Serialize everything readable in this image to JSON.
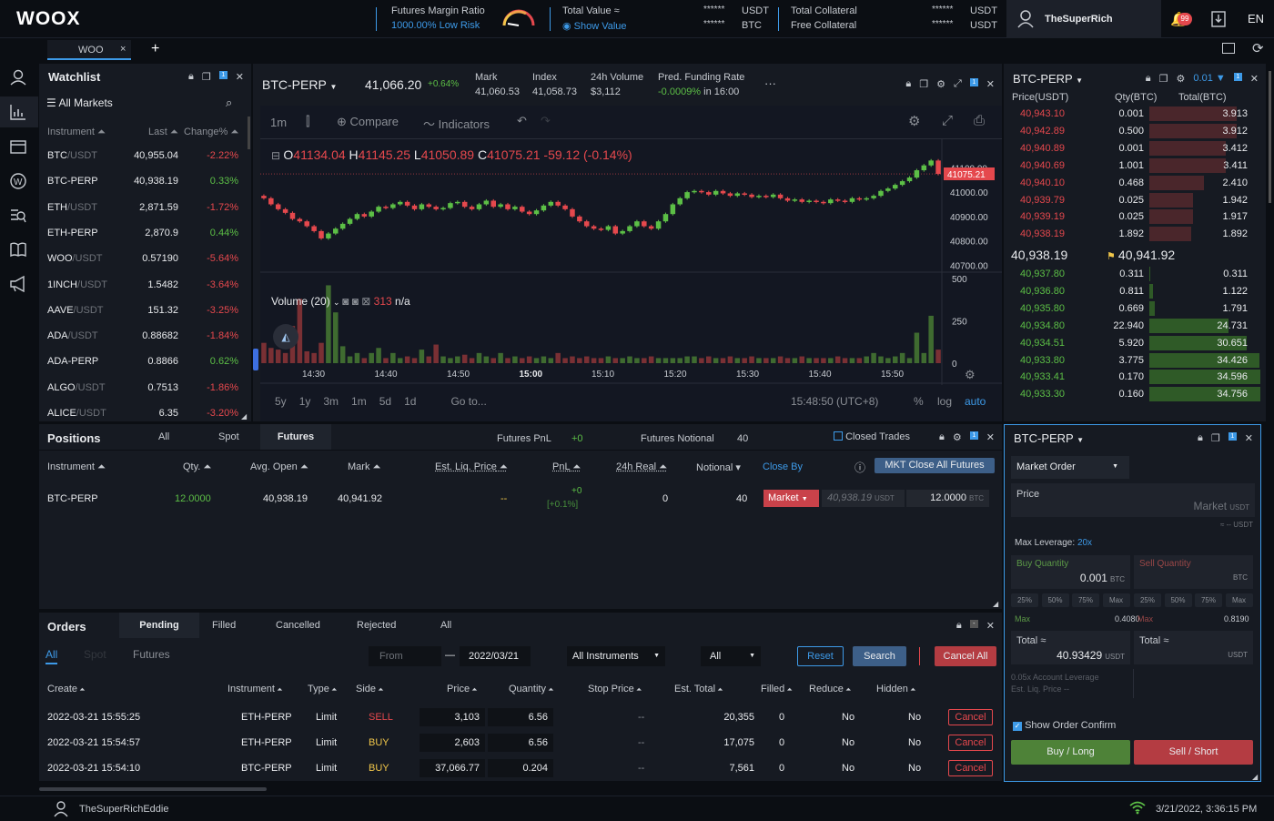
{
  "topbar": {
    "logo": "WOOX",
    "margin_ratio_label": "Futures Margin Ratio",
    "margin_ratio_value": "1000.00%",
    "margin_ratio_risk": "Low Risk",
    "total_value_label": "Total Value ≈",
    "show_value": "Show Value",
    "hidden_1": "******",
    "hidden_1_unit": "USDT",
    "hidden_2": "******",
    "hidden_2_unit": "BTC",
    "total_collateral": "Total Collateral",
    "free_collateral": "Free Collateral",
    "hidden_3": "******",
    "hidden_3_unit": "USDT",
    "hidden_4": "******",
    "hidden_4_unit": "USDT",
    "username": "TheSuperRich",
    "notif_count": "99",
    "lang": "EN"
  },
  "tabs": {
    "tab1": "WOO",
    "close": "×",
    "add": "+"
  },
  "watchlist": {
    "title": "Watchlist",
    "all_markets": "All Markets",
    "cols": [
      "Instrument",
      "Last",
      "Change%"
    ],
    "rows": [
      {
        "base": "BTC",
        "quote": "/USDT",
        "last": "40,955.04",
        "chg": "-2.22%",
        "up": false
      },
      {
        "base": "BTC-PERP",
        "quote": "",
        "last": "40,938.19",
        "chg": "0.33%",
        "up": true
      },
      {
        "base": "ETH",
        "quote": "/USDT",
        "last": "2,871.59",
        "chg": "-1.72%",
        "up": false
      },
      {
        "base": "ETH-PERP",
        "quote": "",
        "last": "2,870.9",
        "chg": "0.44%",
        "up": true
      },
      {
        "base": "WOO",
        "quote": "/USDT",
        "last": "0.57190",
        "chg": "-5.64%",
        "up": false
      },
      {
        "base": "1INCH",
        "quote": "/USDT",
        "last": "1.5482",
        "chg": "-3.64%",
        "up": false
      },
      {
        "base": "AAVE",
        "quote": "/USDT",
        "last": "151.32",
        "chg": "-3.25%",
        "up": false
      },
      {
        "base": "ADA",
        "quote": "/USDT",
        "last": "0.88682",
        "chg": "-1.84%",
        "up": false
      },
      {
        "base": "ADA-PERP",
        "quote": "",
        "last": "0.8866",
        "chg": "0.62%",
        "up": true
      },
      {
        "base": "ALGO",
        "quote": "/USDT",
        "last": "0.7513",
        "chg": "-1.86%",
        "up": false
      },
      {
        "base": "ALICE",
        "quote": "/USDT",
        "last": "6.35",
        "chg": "-3.20%",
        "up": false
      }
    ]
  },
  "chart_header": {
    "symbol": "BTC-PERP",
    "price": "41,066.20",
    "change": "+0.64%",
    "mark_label": "Mark",
    "mark": "41,060.53",
    "index_label": "Index",
    "index": "41,058.73",
    "vol_label": "24h Volume",
    "vol": "$3,112",
    "funding_label": "Pred. Funding Rate",
    "funding": "-0.0009%",
    "funding_time": "in 16:00",
    "more": "···"
  },
  "chart_toolbar": {
    "interval": "1m",
    "compare": "Compare",
    "indicators": "Indicators"
  },
  "ohlc": {
    "o": "41134.04",
    "h": "41145.25",
    "l": "41050.89",
    "c": "41075.21",
    "chg": "-59.12 (-0.14%)"
  },
  "volume_label": {
    "name": "Volume (20)",
    "val": "313",
    "na": "n/a"
  },
  "chart_footer": {
    "ranges": [
      "5y",
      "1y",
      "3m",
      "1m",
      "5d",
      "1d"
    ],
    "goto": "Go to...",
    "time": "15:48:50 (UTC+8)",
    "pct": "%",
    "log": "log",
    "auto": "auto"
  },
  "chart_data": {
    "type": "candlestick",
    "x_ticks": [
      "14:30",
      "14:40",
      "14:50",
      "15:00",
      "15:10",
      "15:20",
      "15:30",
      "15:40",
      "15:50"
    ],
    "y_ticks": [
      "41100.00",
      "41000.00",
      "40900.00",
      "40800.00",
      "40700.00"
    ],
    "last_price_label": "41075.21",
    "ylim": [
      40690,
      41180
    ],
    "volume_ticks": [
      "500",
      "250",
      "0"
    ],
    "close_series": [
      40975,
      40950,
      40930,
      40915,
      40890,
      40880,
      40860,
      40840,
      40810,
      40830,
      40850,
      40870,
      40890,
      40910,
      40900,
      40920,
      40940,
      40935,
      40950,
      40960,
      40945,
      40930,
      40950,
      40940,
      40930,
      40935,
      40955,
      40960,
      40940,
      40930,
      40950,
      40965,
      40940,
      40950,
      40930,
      40940,
      40920,
      40910,
      40925,
      40945,
      40960,
      40945,
      40930,
      40900,
      40880,
      40860,
      40850,
      40845,
      40860,
      40830,
      40840,
      40860,
      40880,
      40860,
      40850,
      40880,
      40910,
      40950,
      40975,
      41000,
      41005,
      41000,
      40990,
      41005,
      40995,
      40985,
      40995,
      40990,
      40980,
      40985,
      40980,
      40990,
      40975,
      40965,
      40970,
      40960,
      40965,
      40960,
      40955,
      40970,
      40965,
      40960,
      40975,
      40970,
      40975,
      40985,
      41005,
      41015,
      41030,
      41045,
      41060,
      41090,
      41110,
      41130,
      41075
    ],
    "volume_series": [
      120,
      90,
      80,
      60,
      220,
      380,
      70,
      60,
      120,
      460,
      300,
      100,
      40,
      60,
      30,
      60,
      90,
      30,
      60,
      30,
      40,
      30,
      80,
      40,
      110,
      40,
      30,
      40,
      50,
      30,
      60,
      40,
      30,
      60,
      30,
      40,
      30,
      40,
      30,
      40,
      30,
      60,
      30,
      40,
      30,
      40,
      30,
      30,
      40,
      30,
      30,
      40,
      30,
      30,
      40,
      30,
      30,
      30,
      30,
      40,
      40,
      30,
      40,
      30,
      30,
      40,
      30,
      30,
      40,
      30,
      30,
      30,
      40,
      30,
      30,
      40,
      30,
      30,
      30,
      30,
      40,
      30,
      30,
      30,
      40,
      60,
      40,
      30,
      40,
      60,
      30,
      180,
      60,
      280,
      80,
      310
    ]
  },
  "orderbook": {
    "symbol": "BTC-PERP",
    "step": "0.01",
    "cols": [
      "Price(USDT)",
      "Qty(BTC)",
      "Total(BTC)"
    ],
    "asks": [
      [
        "40,943.10",
        "0.001",
        "3.913"
      ],
      [
        "40,942.89",
        "0.500",
        "3.912"
      ],
      [
        "40,940.89",
        "0.001",
        "3.412"
      ],
      [
        "40,940.69",
        "1.001",
        "3.411"
      ],
      [
        "40,940.10",
        "0.468",
        "2.410"
      ],
      [
        "40,939.79",
        "0.025",
        "1.942"
      ],
      [
        "40,939.19",
        "0.025",
        "1.917"
      ],
      [
        "40,938.19",
        "1.892",
        "1.892"
      ]
    ],
    "ask_fill": [
      0.79,
      0.79,
      0.69,
      0.69,
      0.49,
      0.39,
      0.39,
      0.38
    ],
    "mid_price": "40,938.19",
    "mark_price": "40,941.92",
    "bids": [
      [
        "40,937.80",
        "0.311",
        "0.311"
      ],
      [
        "40,936.80",
        "0.811",
        "1.122"
      ],
      [
        "40,935.80",
        "0.669",
        "1.791"
      ],
      [
        "40,934.80",
        "22.940",
        "24.731"
      ],
      [
        "40,934.51",
        "5.920",
        "30.651"
      ],
      [
        "40,933.80",
        "3.775",
        "34.426"
      ],
      [
        "40,933.41",
        "0.170",
        "34.596"
      ],
      [
        "40,933.30",
        "0.160",
        "34.756"
      ]
    ],
    "bid_fill": [
      0.01,
      0.03,
      0.05,
      0.71,
      0.88,
      0.99,
      1.0,
      1.0
    ]
  },
  "positions": {
    "title": "Positions",
    "tabs": [
      "All",
      "Spot",
      "Futures"
    ],
    "pnl_label": "Futures PnL",
    "pnl": "+0",
    "notional_label": "Futures Notional",
    "notional": "40",
    "closed_trades": "Closed Trades",
    "cols": [
      "Instrument",
      "Qty.",
      "Avg. Open",
      "Mark",
      "Est. Liq. Price",
      "PnL",
      "24h Real",
      "Notional",
      "Close By"
    ],
    "mkt_close": "MKT Close All Futures",
    "row": {
      "inst": "BTC-PERP",
      "qty": "12.0000",
      "avg": "40,938.19",
      "mark": "40,941.92",
      "liq": "--",
      "pnl": "+0",
      "pnl_pct": "[+0.1%]",
      "real": "0",
      "notional": "40",
      "type": "Market",
      "price_ph": "40,938.19",
      "price_unit": "USDT",
      "qty_val": "12.0000",
      "qty_unit": "BTC"
    }
  },
  "orders": {
    "title": "Orders",
    "tabs": [
      "Pending",
      "Filled",
      "Cancelled",
      "Rejected",
      "All"
    ],
    "subtabs": [
      "All",
      "Spot",
      "Futures"
    ],
    "from": "From",
    "dash": "—",
    "to": "2022/03/21",
    "instruments": "All Instruments",
    "side": "All",
    "reset": "Reset",
    "search": "Search",
    "cancel_all": "Cancel All",
    "cols": [
      "Create",
      "Instrument",
      "Type",
      "Side",
      "Price",
      "Quantity",
      "Stop Price",
      "Est. Total",
      "Filled",
      "Reduce",
      "Hidden"
    ],
    "rows": [
      {
        "create": "2022-03-21 15:55:25",
        "inst": "ETH-PERP",
        "type": "Limit",
        "side": "SELL",
        "price": "3,103",
        "qty": "6.56",
        "stop": "--",
        "total": "20,355",
        "filled": "0",
        "reduce": "No",
        "hidden": "No",
        "cancel": "Cancel"
      },
      {
        "create": "2022-03-21 15:54:57",
        "inst": "ETH-PERP",
        "type": "Limit",
        "side": "BUY",
        "price": "2,603",
        "qty": "6.56",
        "stop": "--",
        "total": "17,075",
        "filled": "0",
        "reduce": "No",
        "hidden": "No",
        "cancel": "Cancel"
      },
      {
        "create": "2022-03-21 15:54:10",
        "inst": "BTC-PERP",
        "type": "Limit",
        "side": "BUY",
        "price": "37,066.77",
        "qty": "0.204",
        "stop": "--",
        "total": "7,561",
        "filled": "0",
        "reduce": "No",
        "hidden": "No",
        "cancel": "Cancel"
      }
    ]
  },
  "order_form": {
    "symbol": "BTC-PERP",
    "order_type": "Market Order",
    "price_label": "Price",
    "price_val": "Market",
    "usdt": "USDT",
    "approx": "≈ --",
    "max_lev_label": "Max Leverage:",
    "max_lev": "20x",
    "buy_qty": "Buy Quantity",
    "buy_val": "0.001",
    "sell_qty": "Sell Quantity",
    "btc": "BTC",
    "pcts": [
      "25%",
      "50%",
      "75%",
      "Max"
    ],
    "max_label": "Max",
    "max_buy": "0.4080",
    "max_sell": "0.8190",
    "total_label": "Total",
    "approx_sym": "≈",
    "total_val": "40.93429",
    "acct_lev": "0.05x Account Leverage",
    "est_liq": "Est. Liq. Price --",
    "confirm": "Show Order Confirm",
    "buy": "Buy / Long",
    "sell": "Sell / Short"
  },
  "statusbar": {
    "user": "TheSuperRichEddie",
    "time": "3/21/2022, 3:36:15 PM"
  }
}
